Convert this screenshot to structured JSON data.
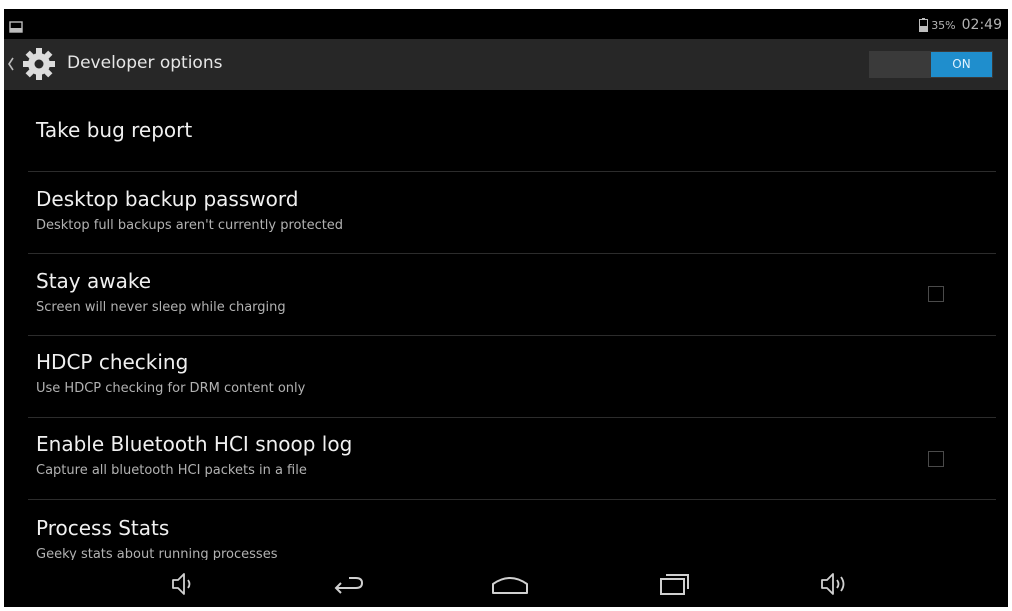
{
  "status_bar": {
    "battery": "35%",
    "time": "02:49"
  },
  "action_bar": {
    "title": "Developer options",
    "switch_state": "ON"
  },
  "preferences": [
    {
      "title": "Take bug report",
      "summary": ""
    },
    {
      "title": "Desktop backup password",
      "summary": "Desktop full backups aren't currently protected"
    },
    {
      "title": "Stay awake",
      "summary": "Screen will never sleep while charging",
      "checked": false
    },
    {
      "title": "HDCP checking",
      "summary": "Use HDCP checking for DRM content only"
    },
    {
      "title": "Enable Bluetooth HCI snoop log",
      "summary": "Capture all bluetooth HCI packets in a file",
      "checked": false
    },
    {
      "title": "Process Stats",
      "summary": "Geeky stats about running processes"
    }
  ],
  "nav_bar": {
    "icons": [
      "volume-down-icon",
      "back-icon",
      "home-icon",
      "recent-apps-icon",
      "volume-up-icon"
    ]
  },
  "colors": {
    "accent": "#1f8ecd",
    "action_bar_bg": "#272727",
    "screen_bg": "#000000"
  }
}
